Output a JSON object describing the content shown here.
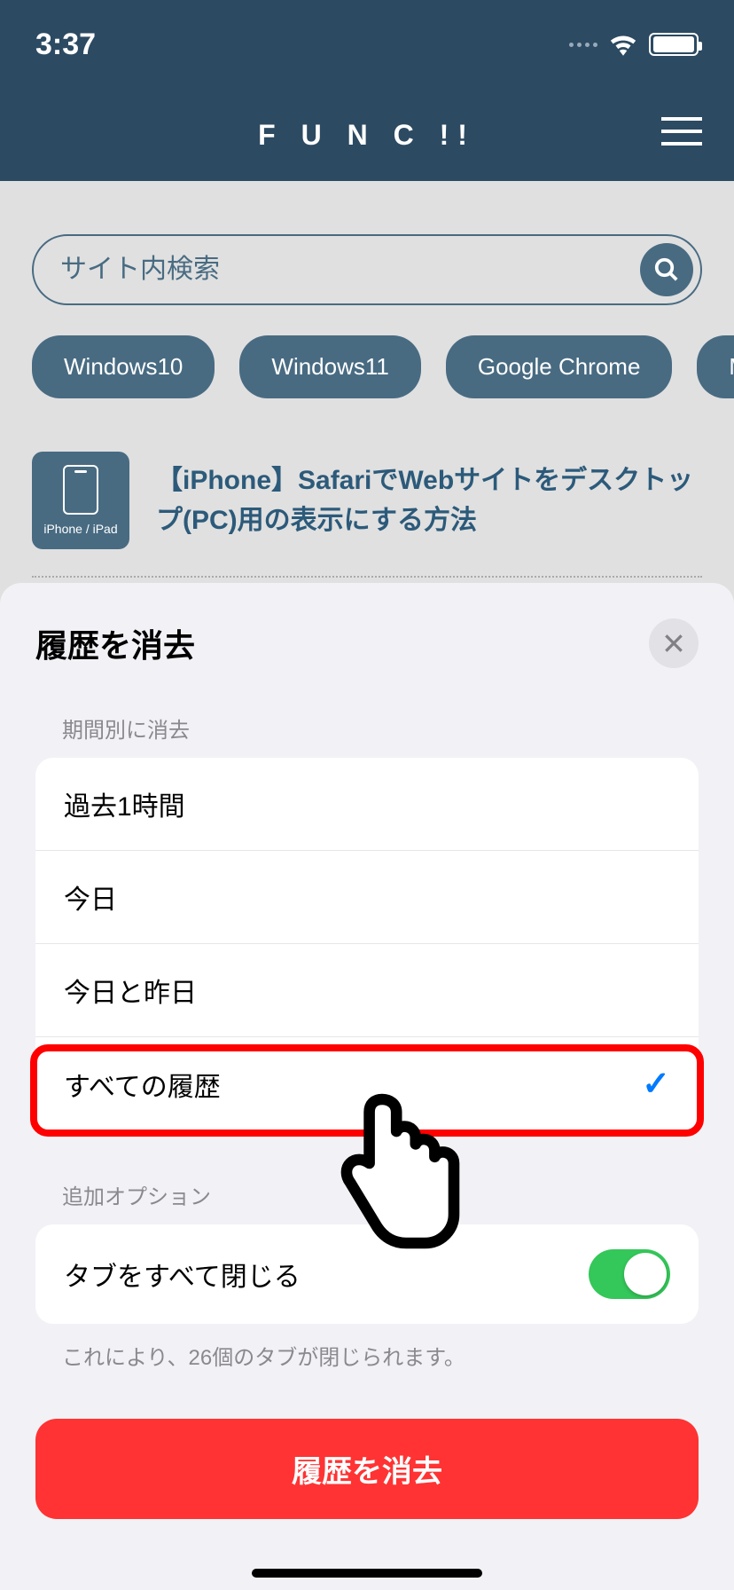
{
  "status": {
    "time": "3:37"
  },
  "header": {
    "logo": "F U N C !!"
  },
  "search": {
    "placeholder": "サイト内検索"
  },
  "tags": [
    "Windows10",
    "Windows11",
    "Google Chrome",
    "Micros"
  ],
  "article": {
    "icon_label": "iPhone / iPad",
    "title": "【iPhone】SafariでWebサイトをデスクトップ(PC)用の表示にする方法"
  },
  "sheet": {
    "title": "履歴を消去",
    "period_label": "期間別に消去",
    "options": [
      "過去1時間",
      "今日",
      "今日と昨日",
      "すべての履歴"
    ],
    "selected_index": 3,
    "extra_label": "追加オプション",
    "close_tabs_label": "タブをすべて閉じる",
    "close_tabs_on": true,
    "footnote": "これにより、26個のタブが閉じられます。",
    "clear_button": "履歴を消去"
  }
}
